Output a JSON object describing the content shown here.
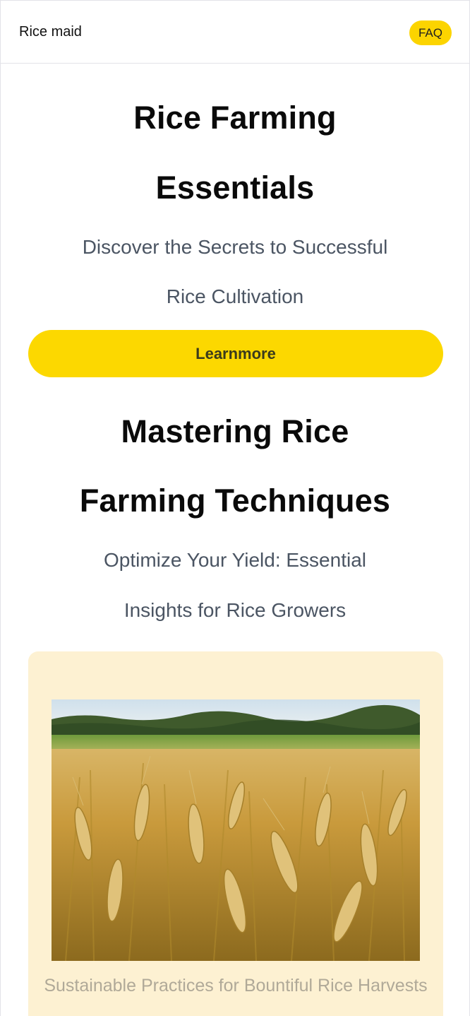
{
  "header": {
    "brand": "Rice maid",
    "faq_label": "FAQ"
  },
  "hero": {
    "title_line1": "Rice Farming",
    "title_line2": "Essentials",
    "subtitle_line1": "Discover the Secrets to Successful",
    "subtitle_line2": "Rice Cultivation",
    "cta_label": "Learnmore"
  },
  "section": {
    "title_line1": "Mastering Rice",
    "title_line2": "Farming Techniques",
    "subtitle_line1": "Optimize Your Yield: Essential",
    "subtitle_line2": "Insights for Rice Growers"
  },
  "card": {
    "caption": "Sustainable Practices for Bountiful Rice Harvests"
  },
  "colors": {
    "accent": "#fcd800",
    "card_bg": "#fdf1d2",
    "subtitle": "#4b5563"
  }
}
